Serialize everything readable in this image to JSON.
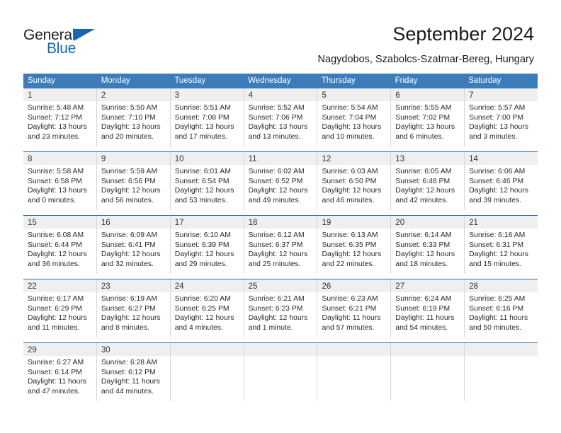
{
  "brand": {
    "name_top": "General",
    "name_bottom": "Blue",
    "color_dark": "#231f20",
    "color_blue": "#1268b3"
  },
  "header": {
    "title": "September 2024",
    "subtitle": "Nagydobos, Szabolcs-Szatmar-Bereg, Hungary"
  },
  "theme": {
    "header_blue": "#3c7cba",
    "row_rule_blue": "#2f6ca6",
    "daynum_band": "#efefef",
    "cell_border": "#d6d6d6"
  },
  "weekdays": [
    "Sunday",
    "Monday",
    "Tuesday",
    "Wednesday",
    "Thursday",
    "Friday",
    "Saturday"
  ],
  "weeks": [
    [
      {
        "day": "1",
        "sunrise": "Sunrise: 5:48 AM",
        "sunset": "Sunset: 7:12 PM",
        "daylight1": "Daylight: 13 hours",
        "daylight2": "and 23 minutes."
      },
      {
        "day": "2",
        "sunrise": "Sunrise: 5:50 AM",
        "sunset": "Sunset: 7:10 PM",
        "daylight1": "Daylight: 13 hours",
        "daylight2": "and 20 minutes."
      },
      {
        "day": "3",
        "sunrise": "Sunrise: 5:51 AM",
        "sunset": "Sunset: 7:08 PM",
        "daylight1": "Daylight: 13 hours",
        "daylight2": "and 17 minutes."
      },
      {
        "day": "4",
        "sunrise": "Sunrise: 5:52 AM",
        "sunset": "Sunset: 7:06 PM",
        "daylight1": "Daylight: 13 hours",
        "daylight2": "and 13 minutes."
      },
      {
        "day": "5",
        "sunrise": "Sunrise: 5:54 AM",
        "sunset": "Sunset: 7:04 PM",
        "daylight1": "Daylight: 13 hours",
        "daylight2": "and 10 minutes."
      },
      {
        "day": "6",
        "sunrise": "Sunrise: 5:55 AM",
        "sunset": "Sunset: 7:02 PM",
        "daylight1": "Daylight: 13 hours",
        "daylight2": "and 6 minutes."
      },
      {
        "day": "7",
        "sunrise": "Sunrise: 5:57 AM",
        "sunset": "Sunset: 7:00 PM",
        "daylight1": "Daylight: 13 hours",
        "daylight2": "and 3 minutes."
      }
    ],
    [
      {
        "day": "8",
        "sunrise": "Sunrise: 5:58 AM",
        "sunset": "Sunset: 6:58 PM",
        "daylight1": "Daylight: 13 hours",
        "daylight2": "and 0 minutes."
      },
      {
        "day": "9",
        "sunrise": "Sunrise: 5:59 AM",
        "sunset": "Sunset: 6:56 PM",
        "daylight1": "Daylight: 12 hours",
        "daylight2": "and 56 minutes."
      },
      {
        "day": "10",
        "sunrise": "Sunrise: 6:01 AM",
        "sunset": "Sunset: 6:54 PM",
        "daylight1": "Daylight: 12 hours",
        "daylight2": "and 53 minutes."
      },
      {
        "day": "11",
        "sunrise": "Sunrise: 6:02 AM",
        "sunset": "Sunset: 6:52 PM",
        "daylight1": "Daylight: 12 hours",
        "daylight2": "and 49 minutes."
      },
      {
        "day": "12",
        "sunrise": "Sunrise: 6:03 AM",
        "sunset": "Sunset: 6:50 PM",
        "daylight1": "Daylight: 12 hours",
        "daylight2": "and 46 minutes."
      },
      {
        "day": "13",
        "sunrise": "Sunrise: 6:05 AM",
        "sunset": "Sunset: 6:48 PM",
        "daylight1": "Daylight: 12 hours",
        "daylight2": "and 42 minutes."
      },
      {
        "day": "14",
        "sunrise": "Sunrise: 6:06 AM",
        "sunset": "Sunset: 6:46 PM",
        "daylight1": "Daylight: 12 hours",
        "daylight2": "and 39 minutes."
      }
    ],
    [
      {
        "day": "15",
        "sunrise": "Sunrise: 6:08 AM",
        "sunset": "Sunset: 6:44 PM",
        "daylight1": "Daylight: 12 hours",
        "daylight2": "and 36 minutes."
      },
      {
        "day": "16",
        "sunrise": "Sunrise: 6:09 AM",
        "sunset": "Sunset: 6:41 PM",
        "daylight1": "Daylight: 12 hours",
        "daylight2": "and 32 minutes."
      },
      {
        "day": "17",
        "sunrise": "Sunrise: 6:10 AM",
        "sunset": "Sunset: 6:39 PM",
        "daylight1": "Daylight: 12 hours",
        "daylight2": "and 29 minutes."
      },
      {
        "day": "18",
        "sunrise": "Sunrise: 6:12 AM",
        "sunset": "Sunset: 6:37 PM",
        "daylight1": "Daylight: 12 hours",
        "daylight2": "and 25 minutes."
      },
      {
        "day": "19",
        "sunrise": "Sunrise: 6:13 AM",
        "sunset": "Sunset: 6:35 PM",
        "daylight1": "Daylight: 12 hours",
        "daylight2": "and 22 minutes."
      },
      {
        "day": "20",
        "sunrise": "Sunrise: 6:14 AM",
        "sunset": "Sunset: 6:33 PM",
        "daylight1": "Daylight: 12 hours",
        "daylight2": "and 18 minutes."
      },
      {
        "day": "21",
        "sunrise": "Sunrise: 6:16 AM",
        "sunset": "Sunset: 6:31 PM",
        "daylight1": "Daylight: 12 hours",
        "daylight2": "and 15 minutes."
      }
    ],
    [
      {
        "day": "22",
        "sunrise": "Sunrise: 6:17 AM",
        "sunset": "Sunset: 6:29 PM",
        "daylight1": "Daylight: 12 hours",
        "daylight2": "and 11 minutes."
      },
      {
        "day": "23",
        "sunrise": "Sunrise: 6:19 AM",
        "sunset": "Sunset: 6:27 PM",
        "daylight1": "Daylight: 12 hours",
        "daylight2": "and 8 minutes."
      },
      {
        "day": "24",
        "sunrise": "Sunrise: 6:20 AM",
        "sunset": "Sunset: 6:25 PM",
        "daylight1": "Daylight: 12 hours",
        "daylight2": "and 4 minutes."
      },
      {
        "day": "25",
        "sunrise": "Sunrise: 6:21 AM",
        "sunset": "Sunset: 6:23 PM",
        "daylight1": "Daylight: 12 hours",
        "daylight2": "and 1 minute."
      },
      {
        "day": "26",
        "sunrise": "Sunrise: 6:23 AM",
        "sunset": "Sunset: 6:21 PM",
        "daylight1": "Daylight: 11 hours",
        "daylight2": "and 57 minutes."
      },
      {
        "day": "27",
        "sunrise": "Sunrise: 6:24 AM",
        "sunset": "Sunset: 6:19 PM",
        "daylight1": "Daylight: 11 hours",
        "daylight2": "and 54 minutes."
      },
      {
        "day": "28",
        "sunrise": "Sunrise: 6:25 AM",
        "sunset": "Sunset: 6:16 PM",
        "daylight1": "Daylight: 11 hours",
        "daylight2": "and 50 minutes."
      }
    ],
    [
      {
        "day": "29",
        "sunrise": "Sunrise: 6:27 AM",
        "sunset": "Sunset: 6:14 PM",
        "daylight1": "Daylight: 11 hours",
        "daylight2": "and 47 minutes."
      },
      {
        "day": "30",
        "sunrise": "Sunrise: 6:28 AM",
        "sunset": "Sunset: 6:12 PM",
        "daylight1": "Daylight: 11 hours",
        "daylight2": "and 44 minutes."
      },
      {
        "day": "",
        "sunrise": "",
        "sunset": "",
        "daylight1": "",
        "daylight2": ""
      },
      {
        "day": "",
        "sunrise": "",
        "sunset": "",
        "daylight1": "",
        "daylight2": ""
      },
      {
        "day": "",
        "sunrise": "",
        "sunset": "",
        "daylight1": "",
        "daylight2": ""
      },
      {
        "day": "",
        "sunrise": "",
        "sunset": "",
        "daylight1": "",
        "daylight2": ""
      },
      {
        "day": "",
        "sunrise": "",
        "sunset": "",
        "daylight1": "",
        "daylight2": ""
      }
    ]
  ]
}
